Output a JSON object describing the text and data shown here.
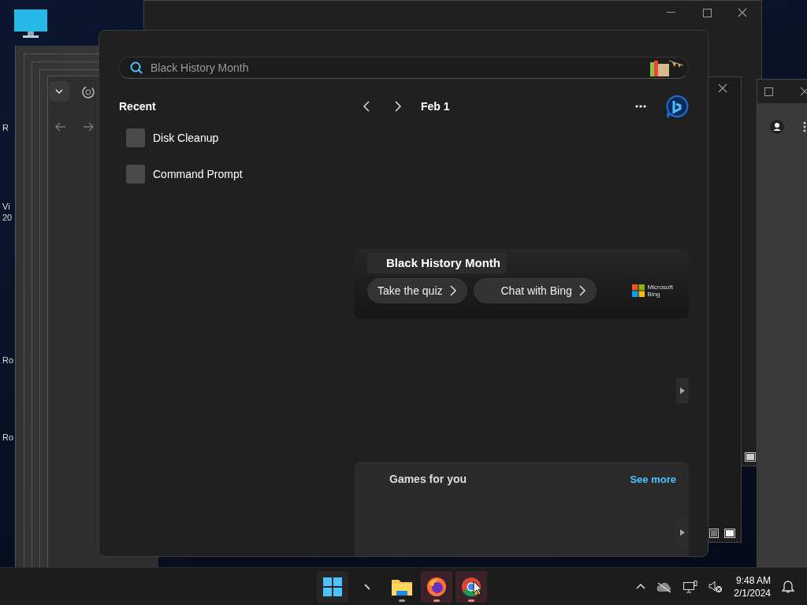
{
  "desktop": {
    "icon_labels": [
      {
        "lines": [
          "R"
        ]
      },
      {
        "lines": [
          "Vi",
          "20"
        ]
      },
      {
        "lines": [
          "Ro"
        ]
      },
      {
        "lines": [
          "Ro"
        ]
      }
    ]
  },
  "search_panel": {
    "search": {
      "placeholder": "Black History Month"
    },
    "recent": {
      "title": "Recent",
      "items": [
        {
          "label": "Disk Cleanup"
        },
        {
          "label": "Command Prompt"
        }
      ]
    },
    "date": "Feb 1",
    "highlight": {
      "title": "Black History Month",
      "buttons": [
        {
          "label": "Take the quiz"
        },
        {
          "label": "Chat with Bing"
        }
      ],
      "brand": [
        "Microsoft",
        "Bing"
      ]
    },
    "games": {
      "title": "Games for you",
      "link": "See more"
    }
  },
  "taskbar": {
    "apps": [
      {
        "kind": "start",
        "running": false,
        "highlighted": false
      },
      {
        "kind": "pen",
        "running": false,
        "highlighted": false
      },
      {
        "kind": "folder",
        "running": true,
        "highlighted": false
      },
      {
        "kind": "fox",
        "running": true,
        "highlighted": true
      },
      {
        "kind": "chrome",
        "running": true,
        "highlighted": true
      }
    ],
    "time": "9:48 AM",
    "date": "2/1/2024"
  }
}
